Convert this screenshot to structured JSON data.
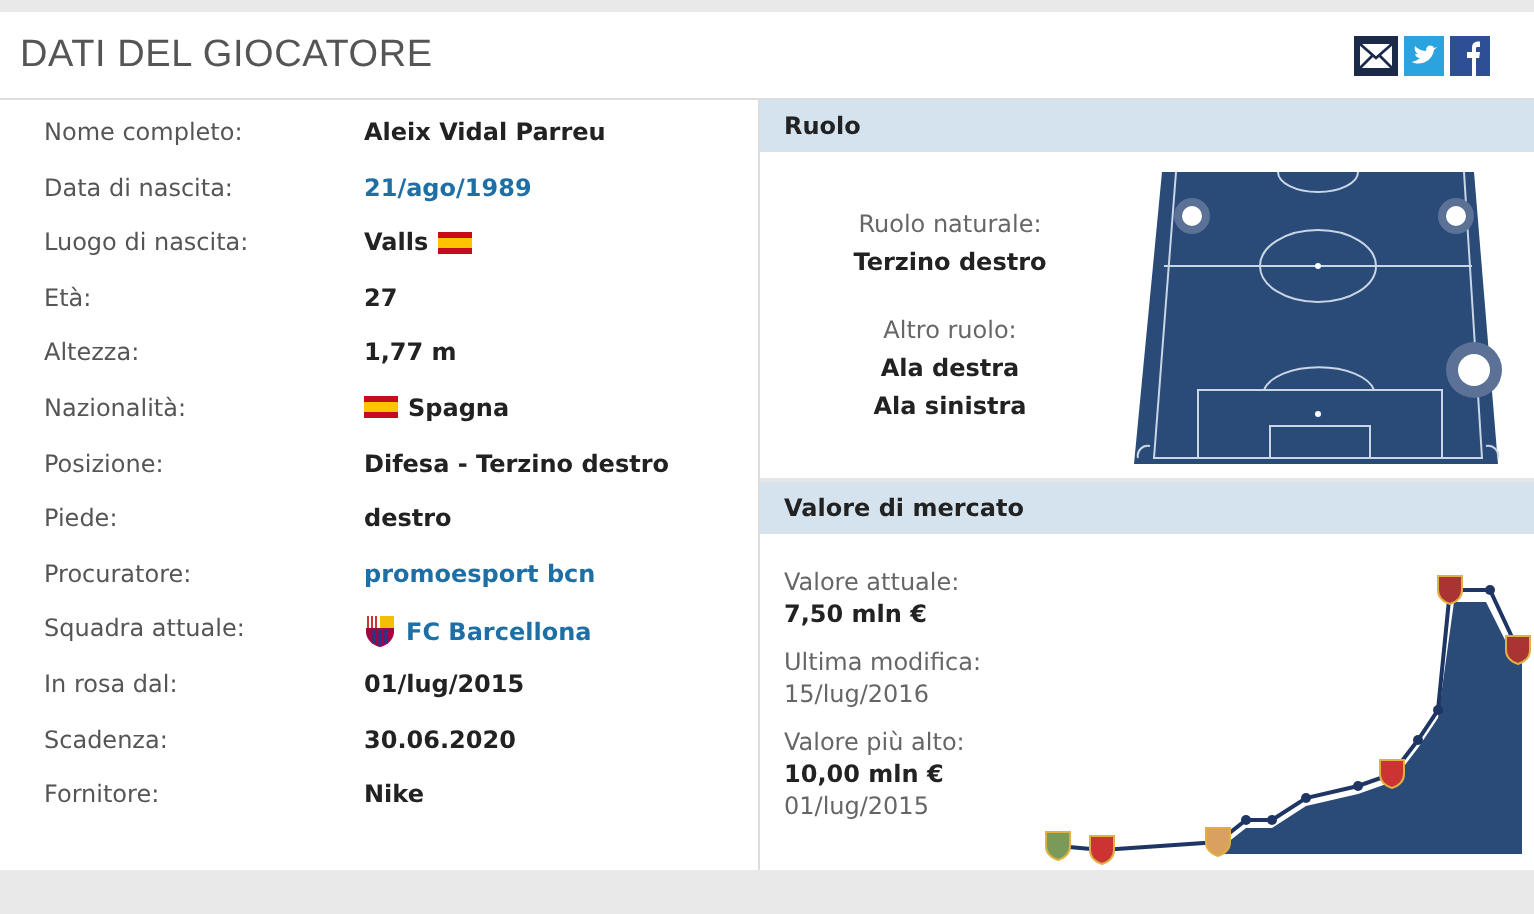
{
  "title": "DATI DEL GIOCATORE",
  "details": [
    {
      "label": "Nome completo:",
      "value": "Aleix Vidal Parreu",
      "kind": "plain"
    },
    {
      "label": "Data di nascita:",
      "value": "21/ago/1989",
      "kind": "link"
    },
    {
      "label": "Luogo di nascita:",
      "value": "Valls",
      "kind": "flag_after"
    },
    {
      "label": "Età:",
      "value": "27",
      "kind": "plain"
    },
    {
      "label": "Altezza:",
      "value": "1,77 m",
      "kind": "plain"
    },
    {
      "label": "Nazionalità:",
      "value": "Spagna",
      "kind": "flag_before"
    },
    {
      "label": "Posizione:",
      "value": "Difesa - Terzino destro",
      "kind": "plain"
    },
    {
      "label": "Piede:",
      "value": "destro",
      "kind": "plain"
    },
    {
      "label": "Procuratore:",
      "value": "promoesport bcn",
      "kind": "link"
    },
    {
      "label": "Squadra attuale:",
      "value": "FC Barcellona",
      "kind": "club"
    },
    {
      "label": "In rosa dal:",
      "value": "01/lug/2015",
      "kind": "plain"
    },
    {
      "label": "Scadenza:",
      "value": "30.06.2020",
      "kind": "plain"
    },
    {
      "label": "Fornitore:",
      "value": "Nike",
      "kind": "plain"
    }
  ],
  "role": {
    "heading": "Ruolo",
    "natural_label": "Ruolo naturale:",
    "natural": "Terzino destro",
    "other_label": "Altro ruolo:",
    "other": [
      "Ala destra",
      "Ala sinistra"
    ]
  },
  "market": {
    "heading": "Valore di mercato",
    "items": [
      {
        "label": "Valore attuale:",
        "value": "7,50 mln €",
        "bold": true
      },
      {
        "label": "Ultima modifica:",
        "value": "15/lug/2016",
        "bold": false
      },
      {
        "label": "Valore più alto:",
        "value": "10,00 mln €",
        "bold": true,
        "note": "01/lug/2015"
      }
    ]
  }
}
